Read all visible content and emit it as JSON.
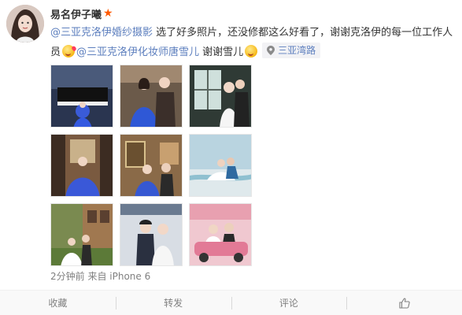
{
  "post": {
    "username": "易名伊子曦",
    "badge_icon": "star-icon",
    "text": {
      "mention_1": "@三亚克洛伊婚纱摄影",
      "body_1": " 选了好多照片，还没修都这么好看了，谢谢克洛伊的每一位工作人员",
      "mention_2": "@三亚克洛伊化妆师唐雪儿",
      "body_2": " 谢谢雪儿",
      "location": "三亚湾路"
    },
    "meta": "2分钟前 来自 iPhone 6",
    "photos": [
      {
        "name": "piano-couple-photo"
      },
      {
        "name": "blue-gown-couple-photo"
      },
      {
        "name": "window-couple-photo"
      },
      {
        "name": "bride-corridor-photo"
      },
      {
        "name": "couple-study-photo"
      },
      {
        "name": "beach-couple-photo"
      },
      {
        "name": "garden-house-photo"
      },
      {
        "name": "studio-couple-photo"
      },
      {
        "name": "pink-car-couple-photo"
      }
    ]
  },
  "actions": {
    "favorite": "收藏",
    "repost": "转发",
    "comment": "评论",
    "like_icon": "thumbs-up-icon"
  },
  "colors": {
    "link": "#5d7fbe",
    "badge": "#ff5a00",
    "meta_text": "#808080"
  }
}
